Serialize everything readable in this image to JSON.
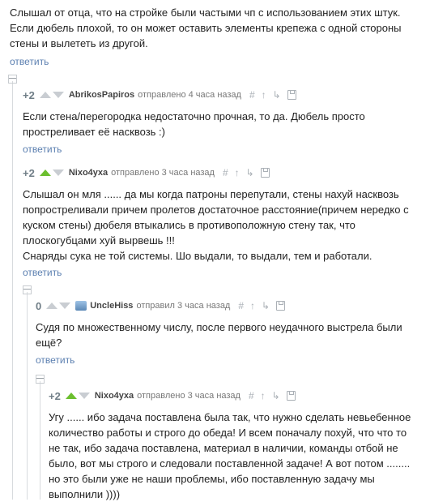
{
  "top": {
    "lines": [
      "Слышал от отца, что на стройке были частыми чп с использованием этих штук.",
      "Если дюбель плохой, то он может оставить элементы крепежа с одной стороны",
      "стены и вылететь из другой."
    ],
    "reply": "ответить"
  },
  "comments": [
    {
      "rating": "+2",
      "user": "AbrikosPapiros",
      "time": "отправлено 4 часа назад",
      "lines": [
        "Если стена/перегородка недостаточно прочная, то да. Дюбель просто",
        "простреливает её насквозь :)"
      ],
      "reply": "ответить"
    },
    {
      "rating": "+2",
      "user": "Nixo4yxa",
      "time": "отправлено 3 часа назад",
      "lines": [
        "Слышал он мля ...... да мы когда патроны перепутали, стены нахуй насквозь",
        "попростреливали причем пролетов достаточное расстояние(причем нередко с",
        "куском стены) дюбеля втыкались в противоположную стену так, что",
        "плоскогубцами хуй вырвешь !!!",
        "Снаряды сука не той системы. Шо выдали, то выдали, тем и работали."
      ],
      "reply": "ответить"
    },
    {
      "rating": "0",
      "user": "UncleHiss",
      "time": "отправил 3 часа назад",
      "lines": [
        "Судя по множественному числу, после первого неудачного выстрела были",
        "ещё?"
      ],
      "reply": "ответить"
    },
    {
      "rating": "+2",
      "user": "Nixo4yxa",
      "time": "отправлено 3 часа назад",
      "lines": [
        "Угу ...... ибо задача поставлена была так, что нужно сделать невьебенное",
        "количество работы и строго до обеда! И всем поначалу похуй, что что то",
        "не так, ибо задача поставлена, материал в наличии, команды отбой не",
        "было, вот мы строго и следовали поставленной задаче! А вот потом ........",
        "но это были уже не наши проблемы, ибо поставленную задачу мы",
        "выполнили ))))"
      ]
    }
  ],
  "icons": {
    "hash": "#",
    "up": "↑",
    "branch": "↳"
  },
  "colors": {
    "link": "#5b7fb0",
    "upvote_active": "#6cbf2f",
    "arrow": "#c9cdd2"
  }
}
